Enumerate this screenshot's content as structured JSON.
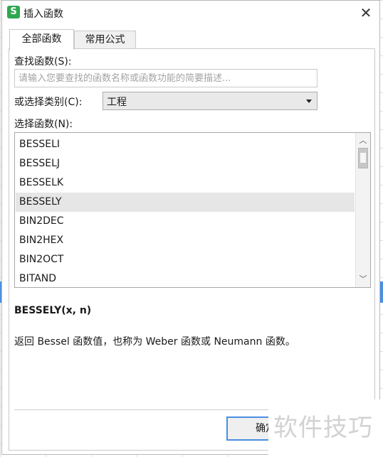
{
  "dialog": {
    "app_icon_letter": "S",
    "title": "插入函数",
    "close_glyph": "✕"
  },
  "tabs": [
    {
      "label": "全部函数",
      "active": true
    },
    {
      "label": "常用公式",
      "active": false
    }
  ],
  "search": {
    "label": "查找函数(S):",
    "placeholder": "请输入您要查找的函数名称或函数功能的简要描述...",
    "value": ""
  },
  "category": {
    "label": "或选择类别(C):",
    "selected": "工程"
  },
  "function_list": {
    "label": "选择函数(N):",
    "items": [
      "BESSELI",
      "BESSELJ",
      "BESSELK",
      "BESSELY",
      "BIN2DEC",
      "BIN2HEX",
      "BIN2OCT",
      "BITAND"
    ],
    "selected": "BESSELY"
  },
  "selected_function": {
    "syntax": "BESSELY(x, n)",
    "description": "返回 Bessel 函数值，也称为 Weber 函数或 Neumann 函数。"
  },
  "buttons": {
    "ok": "确定"
  },
  "watermark": "软件技巧",
  "colors": {
    "accent": "#4a8fe0",
    "app_icon": "#2fa84f",
    "selection": "#e6e6e6"
  },
  "icons": {
    "app": "wps-spreadsheet-icon",
    "close": "close-icon",
    "dropdown": "chevron-down-icon",
    "scroll_up": "scroll-up-arrow-icon",
    "scroll_down": "scroll-down-arrow-icon"
  }
}
